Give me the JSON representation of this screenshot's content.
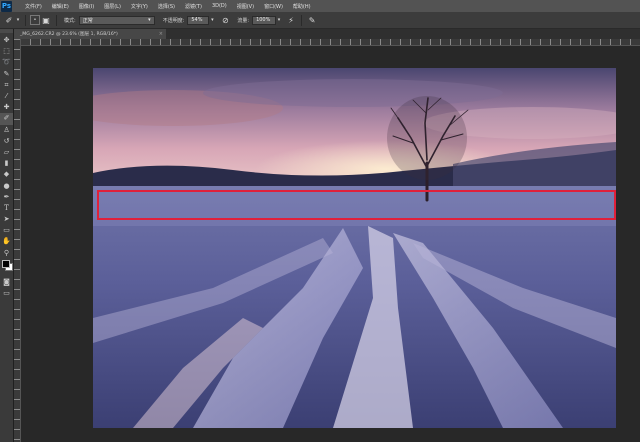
{
  "app": {
    "logo_text": "Ps"
  },
  "menubar": {
    "items": [
      "文件(F)",
      "编辑(E)",
      "图像(I)",
      "图层(L)",
      "文字(Y)",
      "选择(S)",
      "滤镜(T)",
      "3D(D)",
      "视图(V)",
      "窗口(W)",
      "帮助(H)"
    ]
  },
  "options": {
    "mode_label": "模式:",
    "mode_value": "正常",
    "opacity_label": "不透明度:",
    "opacity_value": "54%",
    "flow_label": "流量:",
    "flow_value": "100%"
  },
  "document": {
    "tab_title": "_MG_6262.CR2 @ 23.6% (图层 1, RGB/16*)",
    "close_glyph": "×"
  },
  "tools": [
    {
      "name": "move-tool-icon",
      "glyph": "✥"
    },
    {
      "name": "marquee-tool-icon",
      "glyph": "⬚"
    },
    {
      "name": "lasso-tool-icon",
      "glyph": "➰"
    },
    {
      "name": "quick-select-tool-icon",
      "glyph": "✎"
    },
    {
      "name": "crop-tool-icon",
      "glyph": "⌗"
    },
    {
      "name": "eyedropper-tool-icon",
      "glyph": "⁄"
    },
    {
      "name": "healing-brush-tool-icon",
      "glyph": "✚"
    },
    {
      "name": "brush-tool-icon",
      "glyph": "✐"
    },
    {
      "name": "clone-stamp-tool-icon",
      "glyph": "♙"
    },
    {
      "name": "history-brush-tool-icon",
      "glyph": "↺"
    },
    {
      "name": "eraser-tool-icon",
      "glyph": "▱"
    },
    {
      "name": "gradient-tool-icon",
      "glyph": "▮"
    },
    {
      "name": "blur-tool-icon",
      "glyph": "◆"
    },
    {
      "name": "dodge-tool-icon",
      "glyph": "●"
    },
    {
      "name": "pen-tool-icon",
      "glyph": "✒"
    },
    {
      "name": "type-tool-icon",
      "glyph": "T"
    },
    {
      "name": "path-select-tool-icon",
      "glyph": "➤"
    },
    {
      "name": "shape-tool-icon",
      "glyph": "▭"
    },
    {
      "name": "hand-tool-icon",
      "glyph": "✋"
    },
    {
      "name": "zoom-tool-icon",
      "glyph": "⚲"
    }
  ],
  "colors": {
    "selection_stroke": "#e0203a",
    "foreground_swatch": "#000000",
    "background_swatch": "#ffffff"
  }
}
